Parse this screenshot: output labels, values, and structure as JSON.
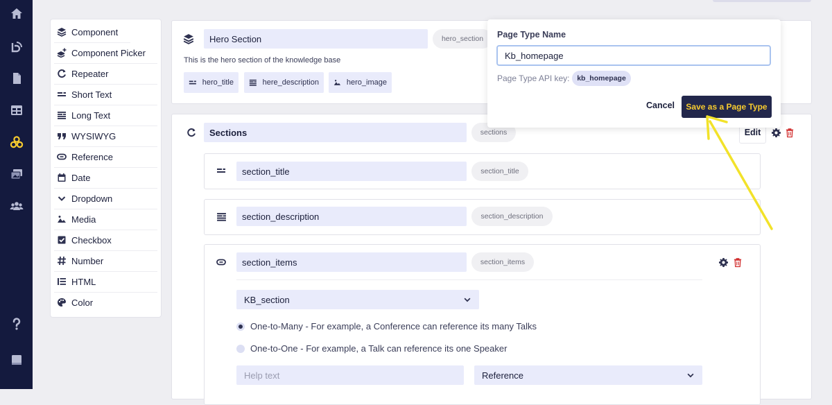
{
  "palette": {
    "items": [
      {
        "label": "Component",
        "icon": "layers-icon"
      },
      {
        "label": "Component Picker",
        "icon": "layers-plus-icon"
      },
      {
        "label": "Repeater",
        "icon": "refresh-icon"
      },
      {
        "label": "Short Text",
        "icon": "short-text-icon"
      },
      {
        "label": "Long Text",
        "icon": "long-text-icon"
      },
      {
        "label": "WYSIWYG",
        "icon": "quote-icon"
      },
      {
        "label": "Reference",
        "icon": "link-icon"
      },
      {
        "label": "Date",
        "icon": "calendar-icon"
      },
      {
        "label": "Dropdown",
        "icon": "chevron-down-icon"
      },
      {
        "label": "Media",
        "icon": "image-icon"
      },
      {
        "label": "Checkbox",
        "icon": "checkbox-icon"
      },
      {
        "label": "Number",
        "icon": "hash-icon"
      },
      {
        "label": "HTML",
        "icon": "list-icon"
      },
      {
        "label": "Color",
        "icon": "palette-icon"
      }
    ]
  },
  "hero": {
    "name": "Hero Section",
    "api": "hero_section",
    "description": "This is the hero section of the knowledge base",
    "chips": [
      {
        "label": "hero_title",
        "icon": "short-text-icon"
      },
      {
        "label": "here_description",
        "icon": "long-text-icon"
      },
      {
        "label": "hero_image",
        "icon": "image-icon"
      }
    ]
  },
  "sections": {
    "name": "Sections",
    "api": "sections",
    "edit_label": "Edit",
    "fields": {
      "title": {
        "name": "section_title",
        "api": "section_title"
      },
      "description": {
        "name": "section_description",
        "api": "section_description"
      },
      "items": {
        "name": "section_items",
        "api": "section_items",
        "reference_target": "KB_section",
        "relation_options": [
          "One-to-Many - For example, a Conference can reference its many Talks",
          "One-to-One - For example, a Talk can reference its one Speaker"
        ],
        "help_placeholder": "Help text",
        "field_type": "Reference"
      }
    }
  },
  "popover": {
    "name_label": "Page Type Name",
    "name_value": "Kb_homepage",
    "api_label": "Page Type API key:",
    "api_value": "kb_homepage",
    "cancel_label": "Cancel",
    "save_label": "Save as a Page Type"
  },
  "colors": {
    "nav_bg": "#141a3e",
    "accent_yellow": "#f7cb2f",
    "delete_red": "#d12f2f",
    "input_bg": "#e9ebfb",
    "primary_btn": "#22274b"
  },
  "annotation": {
    "type": "arrow",
    "color": "#f2e22a"
  }
}
